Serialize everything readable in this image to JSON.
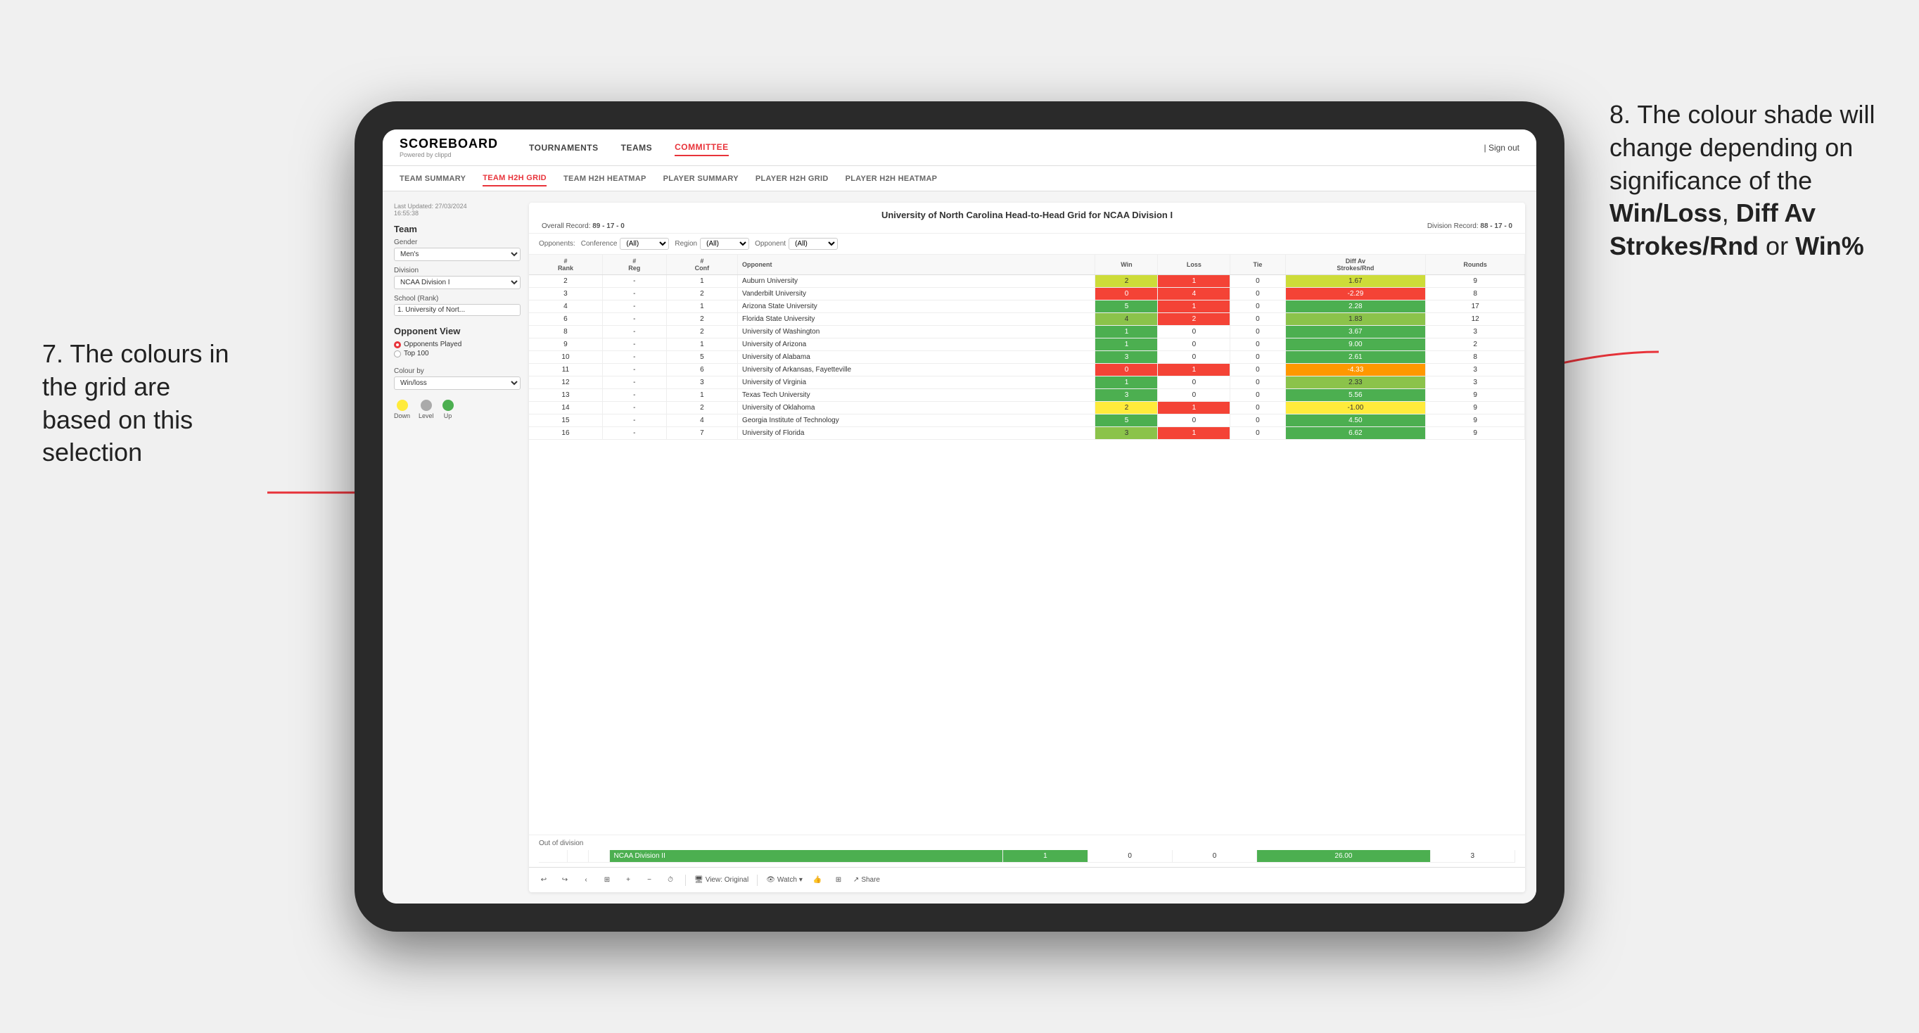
{
  "annotations": {
    "left": "7. The colours in the grid are based on this selection",
    "right_prefix": "8. The colour shade will change depending on significance of the ",
    "right_bold1": "Win/Loss",
    "right_sep1": ", ",
    "right_bold2": "Diff Av Strokes/Rnd",
    "right_sep2": " or ",
    "right_bold3": "Win%"
  },
  "nav": {
    "logo": "SCOREBOARD",
    "logo_sub": "Powered by clippd",
    "items": [
      "TOURNAMENTS",
      "TEAMS",
      "COMMITTEE"
    ],
    "active_item": "COMMITTEE",
    "sign_out": "Sign out"
  },
  "sub_nav": {
    "items": [
      "TEAM SUMMARY",
      "TEAM H2H GRID",
      "TEAM H2H HEATMAP",
      "PLAYER SUMMARY",
      "PLAYER H2H GRID",
      "PLAYER H2H HEATMAP"
    ],
    "active_item": "TEAM H2H GRID"
  },
  "sidebar": {
    "timestamp": "Last Updated: 27/03/2024\n16:55:38",
    "team_section_title": "Team",
    "gender_label": "Gender",
    "gender_value": "Men's",
    "division_label": "Division",
    "division_value": "NCAA Division I",
    "school_label": "School (Rank)",
    "school_value": "1. University of Nort...",
    "opponent_view_label": "Opponent View",
    "radio_opponents": "Opponents Played",
    "radio_top100": "Top 100",
    "colour_by_label": "Colour by",
    "colour_by_value": "Win/loss",
    "legend": {
      "down": "Down",
      "level": "Level",
      "up": "Up"
    }
  },
  "grid": {
    "title": "University of North Carolina Head-to-Head Grid for NCAA Division I",
    "overall_record_label": "Overall Record:",
    "overall_record": "89 - 17 - 0",
    "division_record_label": "Division Record:",
    "division_record": "88 - 17 - 0",
    "filters": {
      "opponents_label": "Opponents:",
      "conference_label": "Conference",
      "conference_value": "(All)",
      "region_label": "Region",
      "region_value": "(All)",
      "opponent_label": "Opponent",
      "opponent_value": "(All)"
    },
    "table_headers": [
      "#\nRank",
      "#\nReg",
      "#\nConf",
      "Opponent",
      "Win",
      "Loss",
      "Tie",
      "Diff Av\nStrokes/Rnd",
      "Rounds"
    ],
    "rows": [
      {
        "rank": "2",
        "reg": "-",
        "conf": "1",
        "opponent": "Auburn University",
        "win": "2",
        "loss": "1",
        "tie": "0",
        "diff": "1.67",
        "rounds": "9",
        "win_color": "green_light",
        "diff_color": "green_light"
      },
      {
        "rank": "3",
        "reg": "-",
        "conf": "2",
        "opponent": "Vanderbilt University",
        "win": "0",
        "loss": "4",
        "tie": "0",
        "diff": "-2.29",
        "rounds": "8",
        "win_color": "red",
        "diff_color": "red"
      },
      {
        "rank": "4",
        "reg": "-",
        "conf": "1",
        "opponent": "Arizona State University",
        "win": "5",
        "loss": "1",
        "tie": "0",
        "diff": "2.28",
        "rounds": "17",
        "win_color": "green_dark",
        "diff_color": "green_dark"
      },
      {
        "rank": "6",
        "reg": "-",
        "conf": "2",
        "opponent": "Florida State University",
        "win": "4",
        "loss": "2",
        "tie": "0",
        "diff": "1.83",
        "rounds": "12",
        "win_color": "green_mid",
        "diff_color": "green_mid"
      },
      {
        "rank": "8",
        "reg": "-",
        "conf": "2",
        "opponent": "University of Washington",
        "win": "1",
        "loss": "0",
        "tie": "0",
        "diff": "3.67",
        "rounds": "3",
        "win_color": "green_dark",
        "diff_color": "green_dark"
      },
      {
        "rank": "9",
        "reg": "-",
        "conf": "1",
        "opponent": "University of Arizona",
        "win": "1",
        "loss": "0",
        "tie": "0",
        "diff": "9.00",
        "rounds": "2",
        "win_color": "green_dark",
        "diff_color": "green_dark"
      },
      {
        "rank": "10",
        "reg": "-",
        "conf": "5",
        "opponent": "University of Alabama",
        "win": "3",
        "loss": "0",
        "tie": "0",
        "diff": "2.61",
        "rounds": "8",
        "win_color": "green_dark",
        "diff_color": "green_dark"
      },
      {
        "rank": "11",
        "reg": "-",
        "conf": "6",
        "opponent": "University of Arkansas, Fayetteville",
        "win": "0",
        "loss": "1",
        "tie": "0",
        "diff": "-4.33",
        "rounds": "3",
        "win_color": "red",
        "diff_color": "orange"
      },
      {
        "rank": "12",
        "reg": "-",
        "conf": "3",
        "opponent": "University of Virginia",
        "win": "1",
        "loss": "0",
        "tie": "0",
        "diff": "2.33",
        "rounds": "3",
        "win_color": "green_dark",
        "diff_color": "green_mid"
      },
      {
        "rank": "13",
        "reg": "-",
        "conf": "1",
        "opponent": "Texas Tech University",
        "win": "3",
        "loss": "0",
        "tie": "0",
        "diff": "5.56",
        "rounds": "9",
        "win_color": "green_dark",
        "diff_color": "green_dark"
      },
      {
        "rank": "14",
        "reg": "-",
        "conf": "2",
        "opponent": "University of Oklahoma",
        "win": "2",
        "loss": "1",
        "tie": "0",
        "diff": "-1.00",
        "rounds": "9",
        "win_color": "yellow",
        "diff_color": "yellow"
      },
      {
        "rank": "15",
        "reg": "-",
        "conf": "4",
        "opponent": "Georgia Institute of Technology",
        "win": "5",
        "loss": "0",
        "tie": "0",
        "diff": "4.50",
        "rounds": "9",
        "win_color": "green_dark",
        "diff_color": "green_dark"
      },
      {
        "rank": "16",
        "reg": "-",
        "conf": "7",
        "opponent": "University of Florida",
        "win": "3",
        "loss": "1",
        "tie": "0",
        "diff": "6.62",
        "rounds": "9",
        "win_color": "green_mid",
        "diff_color": "green_dark"
      }
    ],
    "out_of_division_label": "Out of division",
    "out_of_division_row": {
      "name": "NCAA Division II",
      "win": "1",
      "loss": "0",
      "tie": "0",
      "diff": "26.00",
      "rounds": "3",
      "color": "green_dark"
    }
  },
  "toolbar": {
    "view_original": "View: Original",
    "watch": "Watch",
    "share": "Share"
  },
  "colors": {
    "green_dark": "#4caf50",
    "green_mid": "#8bc34a",
    "green_light": "#cddc39",
    "yellow": "#ffeb3b",
    "orange": "#ff9800",
    "red": "#f44336",
    "brand": "#e8333a"
  }
}
